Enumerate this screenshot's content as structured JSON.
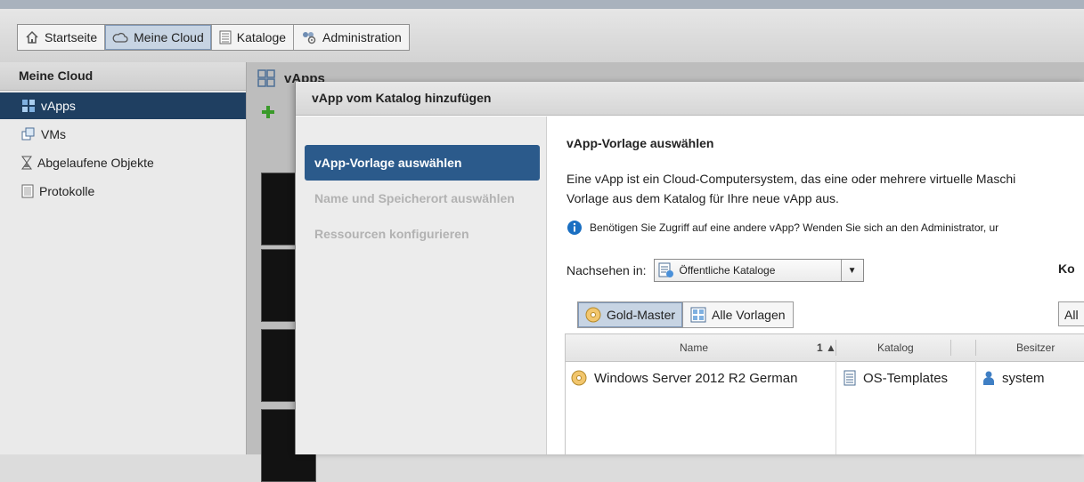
{
  "nav": {
    "tabs": [
      {
        "label": "Startseite",
        "icon": "home-icon"
      },
      {
        "label": "Meine Cloud",
        "icon": "cloud-icon"
      },
      {
        "label": "Kataloge",
        "icon": "catalog-icon"
      },
      {
        "label": "Administration",
        "icon": "admin-icon"
      }
    ]
  },
  "sidebar": {
    "title": "Meine Cloud",
    "items": [
      {
        "label": "vApps",
        "icon": "vapps-icon"
      },
      {
        "label": "VMs",
        "icon": "vms-icon"
      },
      {
        "label": "Abgelaufene Objekte",
        "icon": "hourglass-icon"
      },
      {
        "label": "Protokolle",
        "icon": "logs-icon"
      }
    ]
  },
  "background": {
    "title": "vApps"
  },
  "dialog": {
    "title": "vApp vom Katalog hinzufügen",
    "steps": [
      "vApp-Vorlage auswählen",
      "Name und Speicherort auswählen",
      "Ressourcen konfigurieren"
    ],
    "content": {
      "title": "vApp-Vorlage auswählen",
      "desc_line1": "Eine vApp ist ein Cloud-Computersystem, das eine oder mehrere virtuelle Maschi",
      "desc_line2": "Vorlage aus dem Katalog für Ihre neue vApp aus.",
      "info": "Benötigen Sie Zugriff auf eine andere vApp? Wenden Sie sich an den Administrator, ur",
      "look_in_label": "Nachsehen in:",
      "look_in_value": "Öffentliche Kataloge",
      "ko_label": "Ko",
      "toggle": [
        "Gold-Master",
        "Alle Vorlagen"
      ],
      "all_button": "All",
      "columns": [
        "Name",
        "1 ▲",
        "Katalog",
        "Besitzer"
      ],
      "rows": [
        {
          "name": "Windows Server 2012 R2 German",
          "catalog": "OS-Templates",
          "owner": "system"
        }
      ]
    }
  },
  "colors": {
    "accent": "#2b5a8b",
    "sidebar_active": "#1f3f61",
    "toggle_active": "#c7d4e3"
  }
}
